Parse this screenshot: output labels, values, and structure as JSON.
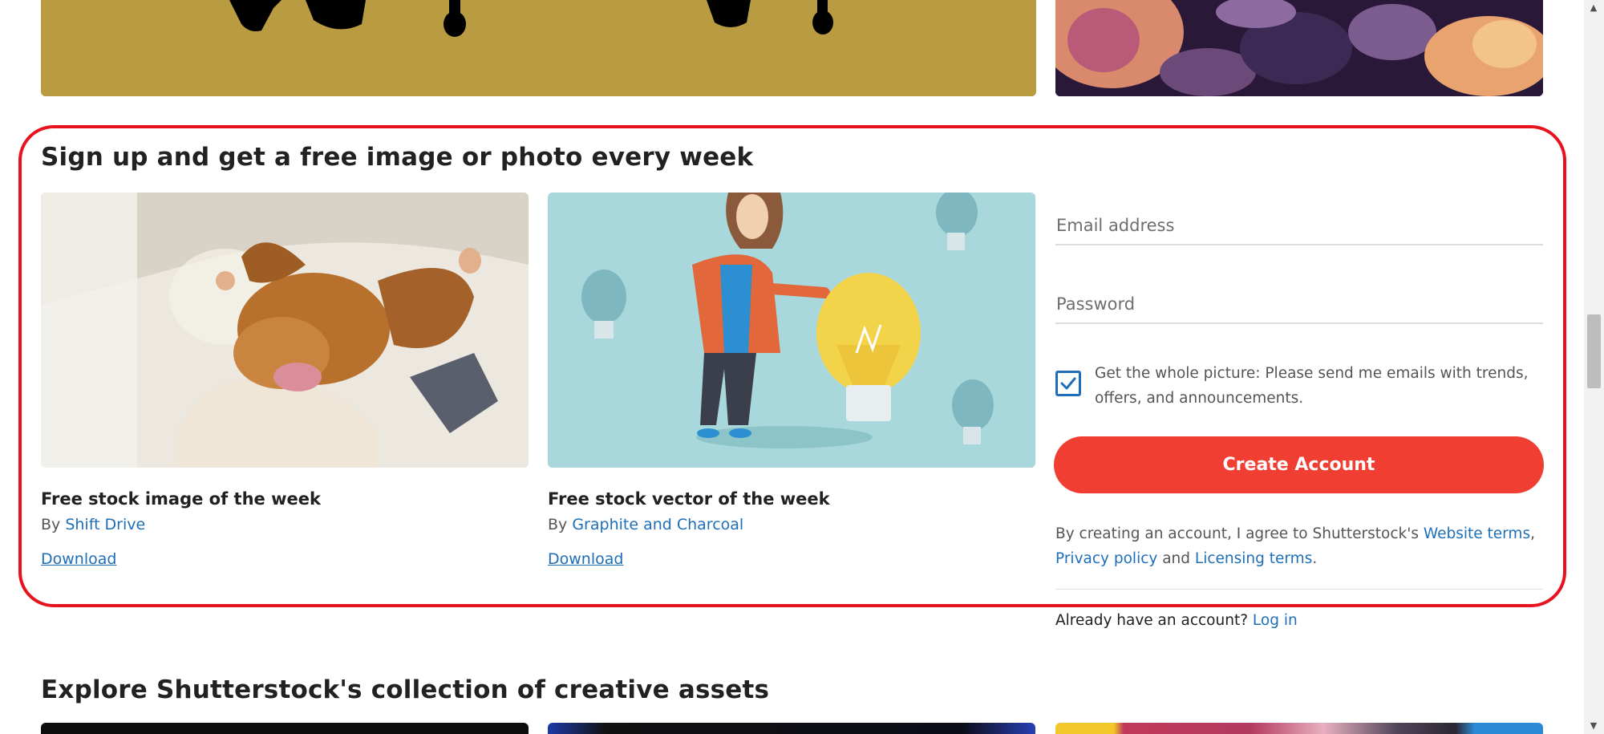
{
  "signup": {
    "title": "Sign up and get a free image or photo every week",
    "cards": [
      {
        "title": "Free stock image of the week",
        "by_prefix": "By ",
        "author": "Shift Drive",
        "download_label": "Download"
      },
      {
        "title": "Free stock vector of the week",
        "by_prefix": "By ",
        "author": "Graphite and Charcoal",
        "download_label": "Download"
      }
    ],
    "form": {
      "email_placeholder": "Email address",
      "password_placeholder": "Password",
      "optin_checked": true,
      "optin_text": "Get the whole picture: Please send me emails with trends, offers, and announcements.",
      "create_button_label": "Create Account",
      "terms_prefix": "By creating an account, I agree to Shutterstock's ",
      "website_terms_link": "Website terms",
      "terms_comma": ",",
      "privacy_link": "Privacy policy",
      "terms_and": " and ",
      "licensing_link": "Licensing terms",
      "terms_period": ".",
      "login_prefix": "Already have an account? ",
      "login_link": "Log in"
    }
  },
  "explore": {
    "title": "Explore Shutterstock's collection of creative assets"
  },
  "colors": {
    "accent_red": "#f13e33",
    "link_blue": "#1e6fb8",
    "highlight_red": "#e8121f",
    "mustard": "#b99b42"
  },
  "icons": {
    "checkbox": "checkmark-icon",
    "scroll_up": "scroll-up-arrow-icon",
    "scroll_down": "scroll-down-arrow-icon"
  }
}
